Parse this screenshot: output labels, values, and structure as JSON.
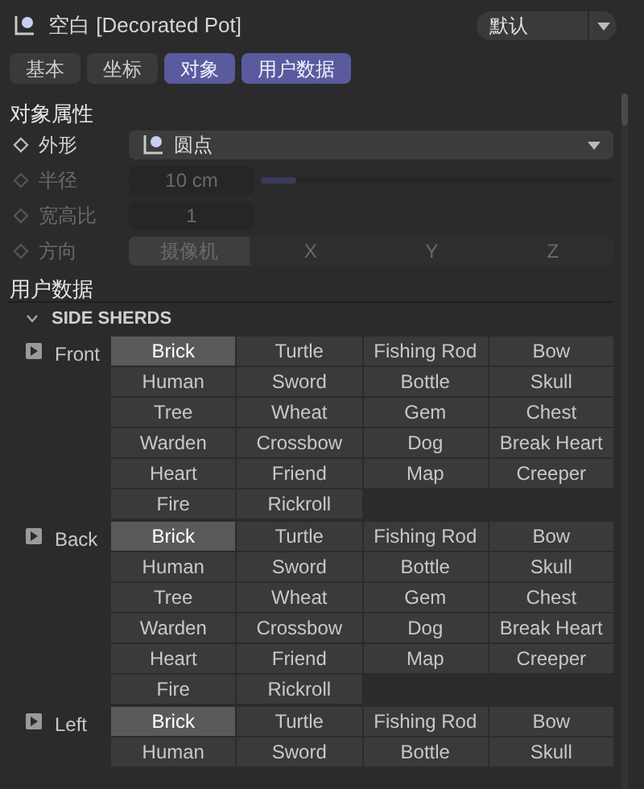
{
  "header": {
    "title": "空白 [Decorated Pot]",
    "mode_select": "默认"
  },
  "tabs": [
    {
      "label": "基本",
      "selected": false
    },
    {
      "label": "坐标",
      "selected": false
    },
    {
      "label": "对象",
      "selected": true
    },
    {
      "label": "用户数据",
      "selected": true
    }
  ],
  "object_section": {
    "title": "对象属性",
    "properties": [
      {
        "kind": "dropdown",
        "label": "外形",
        "disabled": false,
        "value": "圆点"
      },
      {
        "kind": "slider",
        "label": "半径",
        "disabled": true,
        "value": "10 cm",
        "level": 0.1
      },
      {
        "kind": "number",
        "label": "宽高比",
        "disabled": true,
        "value": "1"
      },
      {
        "kind": "segmented",
        "label": "方向",
        "disabled": true,
        "options": [
          {
            "label": "摄像机",
            "selected": true
          },
          {
            "label": "X",
            "selected": false
          },
          {
            "label": "Y",
            "selected": false
          },
          {
            "label": "Z",
            "selected": false
          }
        ]
      }
    ]
  },
  "user_section": {
    "title": "用户数据",
    "group": {
      "title": "SIDE SHERDS",
      "expanded": true,
      "sides": [
        {
          "label": "Front",
          "options": [
            {
              "label": "Brick",
              "selected": true
            },
            {
              "label": "Turtle",
              "selected": false
            },
            {
              "label": "Fishing Rod",
              "selected": false
            },
            {
              "label": "Bow",
              "selected": false
            },
            {
              "label": "Human",
              "selected": false
            },
            {
              "label": "Sword",
              "selected": false
            },
            {
              "label": "Bottle",
              "selected": false
            },
            {
              "label": "Skull",
              "selected": false
            },
            {
              "label": "Tree",
              "selected": false
            },
            {
              "label": "Wheat",
              "selected": false
            },
            {
              "label": "Gem",
              "selected": false
            },
            {
              "label": "Chest",
              "selected": false
            },
            {
              "label": "Warden",
              "selected": false
            },
            {
              "label": "Crossbow",
              "selected": false
            },
            {
              "label": "Dog",
              "selected": false
            },
            {
              "label": "Break Heart",
              "selected": false
            },
            {
              "label": "Heart",
              "selected": false
            },
            {
              "label": "Friend",
              "selected": false
            },
            {
              "label": "Map",
              "selected": false
            },
            {
              "label": "Creeper",
              "selected": false
            },
            {
              "label": "Fire",
              "selected": false
            },
            {
              "label": "Rickroll",
              "selected": false
            }
          ]
        },
        {
          "label": "Back",
          "options": [
            {
              "label": "Brick",
              "selected": true
            },
            {
              "label": "Turtle",
              "selected": false
            },
            {
              "label": "Fishing Rod",
              "selected": false
            },
            {
              "label": "Bow",
              "selected": false
            },
            {
              "label": "Human",
              "selected": false
            },
            {
              "label": "Sword",
              "selected": false
            },
            {
              "label": "Bottle",
              "selected": false
            },
            {
              "label": "Skull",
              "selected": false
            },
            {
              "label": "Tree",
              "selected": false
            },
            {
              "label": "Wheat",
              "selected": false
            },
            {
              "label": "Gem",
              "selected": false
            },
            {
              "label": "Chest",
              "selected": false
            },
            {
              "label": "Warden",
              "selected": false
            },
            {
              "label": "Crossbow",
              "selected": false
            },
            {
              "label": "Dog",
              "selected": false
            },
            {
              "label": "Break Heart",
              "selected": false
            },
            {
              "label": "Heart",
              "selected": false
            },
            {
              "label": "Friend",
              "selected": false
            },
            {
              "label": "Map",
              "selected": false
            },
            {
              "label": "Creeper",
              "selected": false
            },
            {
              "label": "Fire",
              "selected": false
            },
            {
              "label": "Rickroll",
              "selected": false
            }
          ]
        },
        {
          "label": "Left",
          "options": [
            {
              "label": "Brick",
              "selected": true
            },
            {
              "label": "Turtle",
              "selected": false
            },
            {
              "label": "Fishing Rod",
              "selected": false
            },
            {
              "label": "Bow",
              "selected": false
            },
            {
              "label": "Human",
              "selected": false
            },
            {
              "label": "Sword",
              "selected": false
            },
            {
              "label": "Bottle",
              "selected": false
            },
            {
              "label": "Skull",
              "selected": false
            }
          ]
        }
      ]
    }
  }
}
